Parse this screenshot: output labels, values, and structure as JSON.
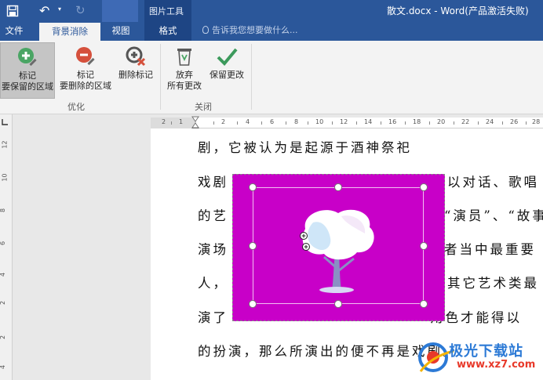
{
  "titlebar": {
    "context_tool_group": "图片工具",
    "document_title": "散文.docx - Word(产品激活失败)"
  },
  "tabs": [
    {
      "label": "文件"
    },
    {
      "label": "背景消除"
    },
    {
      "label": "视图"
    },
    {
      "label": "格式"
    }
  ],
  "tell_me": {
    "placeholder": "告诉我您想要做什么..."
  },
  "ribbon": {
    "mark_keep": {
      "line1": "标记",
      "line2": "要保留的区域"
    },
    "mark_remove": {
      "line1": "标记",
      "line2": "要删除的区域"
    },
    "delete_mark": {
      "label": "删除标记"
    },
    "discard": {
      "line1": "放弃",
      "line2": "所有更改"
    },
    "keep_changes": {
      "label": "保留更改"
    },
    "group_refine": "优化",
    "group_close": "关闭"
  },
  "ruler": {
    "h_numbers": [
      "2",
      "1",
      "2",
      "4",
      "6",
      "8",
      "10",
      "12",
      "14",
      "16",
      "18",
      "20",
      "22",
      "24",
      "26",
      "28"
    ],
    "v_numbers": [
      "12",
      "10",
      "8",
      "6",
      "4",
      "2",
      "2",
      "4"
    ]
  },
  "document": {
    "lines": [
      "剧，它被认为是起源于酒神祭祀",
      "戏剧",
      "的艺",
      "演场",
      "人，",
      "演了",
      "的扮演，那么所演出的便不再是戏剧。"
    ],
    "lines_right": [
      "以对话、歌唱",
      "“演员”、“故事",
      "者当中最重要",
      "其它艺术类最",
      "角色才能得以"
    ]
  },
  "colors": {
    "word_blue": "#2b579a",
    "removal_magenta": "#c800c8"
  },
  "watermark": {
    "brand": "极光下载站",
    "url": "www.xz7.com"
  }
}
